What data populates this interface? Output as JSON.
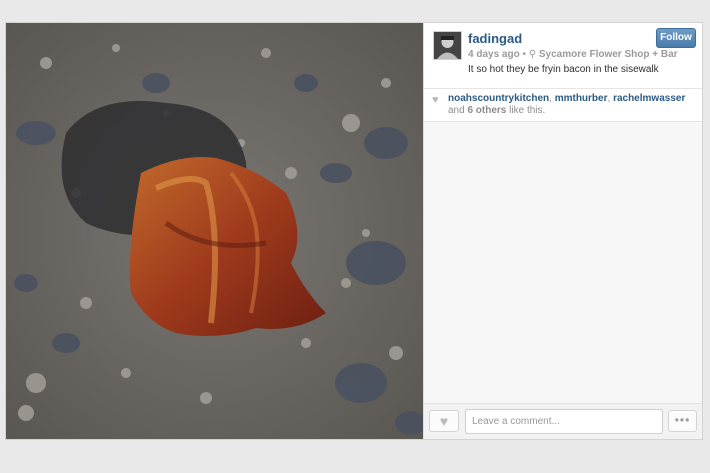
{
  "post": {
    "username": "fadingad",
    "follow_label": "Follow",
    "time_ago": "4 days ago",
    "separator": "•",
    "location_icon": "location-pin-icon",
    "location": "Sycamore Flower Shop + Bar",
    "caption": "It so hot they be fryin bacon in the sisewalk",
    "photo_subject": "bacon-on-sidewalk"
  },
  "likes": {
    "icon": "heart-icon",
    "users": [
      "noahscountrykitchen",
      "mmthurber",
      "rachelmwasser"
    ],
    "comma": ",",
    "and_text": "and",
    "others_count": "6 others",
    "suffix": "like this."
  },
  "footer": {
    "like_icon": "heart-icon",
    "comment_placeholder": "Leave a comment...",
    "more_label": "•••"
  },
  "colors": {
    "link": "#2b5b84",
    "follow_button": "#4a7bab",
    "background": "#e9e9e9"
  }
}
